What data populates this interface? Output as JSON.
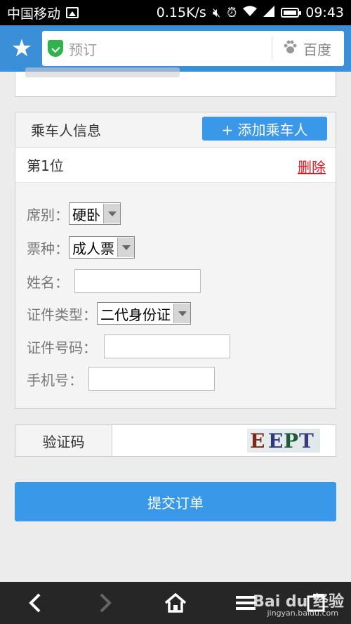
{
  "status_bar": {
    "carrier": "中国移动",
    "speed": "0.15K/s",
    "time": "09:43"
  },
  "browser": {
    "url_text": "预订",
    "search_engine": "百度"
  },
  "passenger": {
    "section_title": "乘车人信息",
    "add_button": "+ 添加乘车人",
    "order_label": "第1位",
    "delete_link": "删除",
    "fields": {
      "seat_label": "席别：",
      "seat_value": "硬卧",
      "ticket_label": "票种：",
      "ticket_value": "成人票",
      "name_label": "姓名：",
      "name_value": "",
      "id_type_label": "证件类型：",
      "id_type_value": "二代身份证",
      "id_number_label": "证件号码：",
      "id_number_value": "",
      "phone_label": "手机号：",
      "phone_value": ""
    }
  },
  "captcha": {
    "label": "验证码",
    "code_chars": [
      "E",
      "E",
      "P",
      "T"
    ]
  },
  "submit_label": "提交订单",
  "watermark": {
    "main": "Bai du 经验",
    "sub": "jingyan.baidu.com"
  },
  "colors": {
    "header_blue": "#3b8fd6",
    "button_blue": "#3a98e8",
    "delete_red": "#e8151c",
    "shield_green": "#2fb34a"
  },
  "icons": [
    "image-icon",
    "mute-icon",
    "alarm-icon",
    "wifi-icon",
    "signal-icon",
    "battery-icon",
    "star-icon",
    "shield-check-icon",
    "paw-icon",
    "back-icon",
    "forward-icon",
    "home-icon",
    "menu-icon",
    "tabs-icon"
  ]
}
